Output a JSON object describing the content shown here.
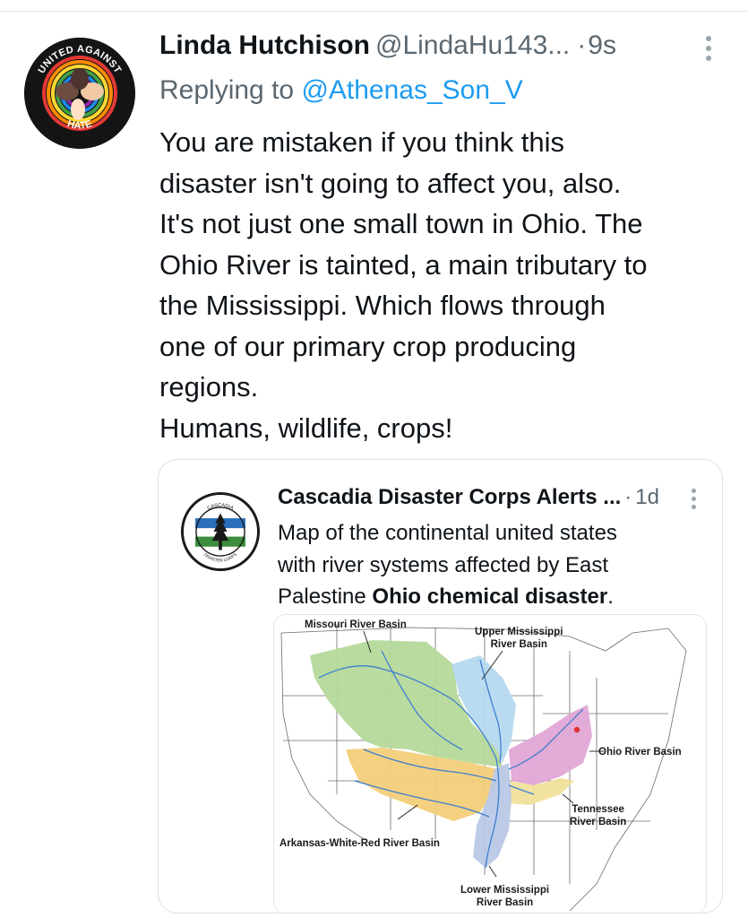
{
  "tweet": {
    "author_name": "Linda Hutchison",
    "handle": "@LindaHu143...",
    "separator": "·",
    "time": "9s",
    "replying_prefix": "Replying to",
    "replying_to": "@Athenas_Son_V",
    "lines": [
      "You are mistaken if you think this",
      "disaster isn't going to affect you, also.",
      "It's not just one small town in Ohio. The",
      "Ohio River is tainted, a main tributary to",
      "the Mississippi. Which flows through",
      "one of our primary crop producing",
      "regions.",
      "Humans, wildlife, crops!"
    ],
    "avatar": {
      "icon": "united-against-hate-avatar",
      "text_top": "UNITED AGAINST",
      "text_bottom": "HATE"
    }
  },
  "quoted": {
    "author_name": "Cascadia Disaster Corps Alerts ...",
    "separator": "·",
    "time": "1d",
    "text_lines": [
      "Map of the continental united states",
      "with river systems affected by East"
    ],
    "text_last_plain": "Palestine ",
    "text_last_bold": "Ohio chemical disaster",
    "text_last_end": ".",
    "avatar": {
      "icon": "cascadia-disaster-corps-logo",
      "text_top": "CASCADIA",
      "text_bottom": "DISASTER CORPS"
    },
    "map": {
      "labels": {
        "missouri": "Missouri River Basin",
        "upper_mississippi_1": "Upper Mississippi",
        "upper_mississippi_2": "River Basin",
        "ohio": "Ohio River Basin",
        "tennessee_1": "Tennessee",
        "tennessee_2": "River Basin",
        "arkansas": "Arkansas-White-Red River Basin",
        "lower_mississippi_1": "Lower Mississippi",
        "lower_mississippi_2": "River Basin"
      },
      "colors": {
        "missouri": "#b5d99a",
        "upper_mississippi": "#b6d9ee",
        "ohio": "#e2a6d6",
        "tennessee": "#f0e29a",
        "arkansas": "#f3cf7a",
        "lower_mississippi": "#b9c8e6",
        "river": "#3d7fd0",
        "spill": "#e0312f"
      }
    }
  },
  "colors": {
    "link": "#1d9bf0",
    "muted": "#5b6770"
  }
}
